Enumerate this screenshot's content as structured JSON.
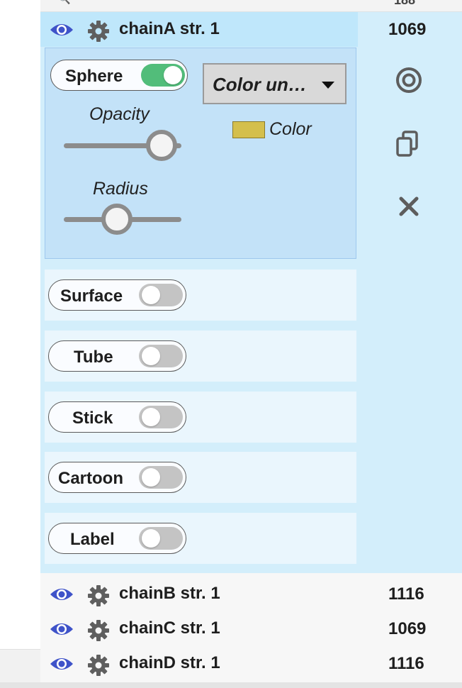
{
  "top_partial": {
    "count": "188"
  },
  "chains": [
    {
      "name": "chainA str. 1",
      "count": "1069",
      "selected": true
    },
    {
      "name": "chainB str. 1",
      "count": "1116"
    },
    {
      "name": "chainC str. 1",
      "count": "1069"
    },
    {
      "name": "chainD str. 1",
      "count": "1116"
    }
  ],
  "sphere": {
    "label": "Sphere",
    "enabled": true,
    "opacity_label": "Opacity",
    "opacity_value": 0.9,
    "radius_label": "Radius",
    "radius_value": 0.45,
    "color_scheme": "Color un…",
    "color_label": "Color",
    "swatch_color": "#d4bf4c"
  },
  "representations": [
    {
      "label": "Surface",
      "enabled": false
    },
    {
      "label": "Tube",
      "enabled": false
    },
    {
      "label": "Stick",
      "enabled": false
    },
    {
      "label": "Cartoon",
      "enabled": false
    },
    {
      "label": "Label",
      "enabled": false
    }
  ],
  "side_actions": [
    "target-icon",
    "copy-icon",
    "close-icon"
  ],
  "colors": {
    "accent": "#3f53c9",
    "toggle_on": "#52bd7a",
    "toggle_off": "#c4c4c4"
  }
}
